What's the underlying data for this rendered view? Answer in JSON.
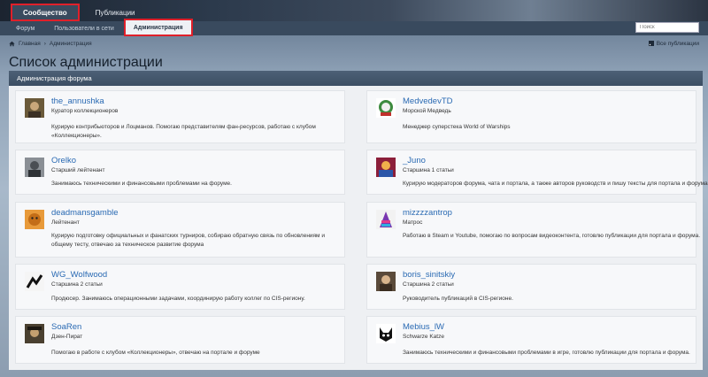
{
  "topnav": {
    "tabs": [
      "Сообщество",
      "Публикации"
    ]
  },
  "subnav": {
    "items": [
      "Форум",
      "Пользователи в сети",
      "Администрация"
    ]
  },
  "search": {
    "placeholder": "Поиск"
  },
  "breadcrumb": {
    "home": "Главная",
    "current": "Администрация"
  },
  "all_publications": "Все публикации",
  "page_title": "Список администрации",
  "section_title": "Администрация форума",
  "members": [
    {
      "name": "the_annushka",
      "rank": "Куратор коллекционеров",
      "bio": "Курирую контрибьюторов и Лоцманов. Помогаю представителям фан-ресурсов, работаю с клубом «Коллекционеры»."
    },
    {
      "name": "MedvedevTD",
      "rank": "Морской Медведь",
      "bio": "Менеджер суперстека World of Warships"
    },
    {
      "name": "Orelko",
      "rank": "Старший лейтенант",
      "bio": "Занимаюсь техническими и финансовыми проблемами на форуме."
    },
    {
      "name": "_Juno",
      "rank": "Старшина 1 статьи",
      "bio": "Курирую модераторов форума, чата и портала, а также авторов руководств и пишу тексты для портала и форума"
    },
    {
      "name": "deadmansgamble",
      "rank": "Лейтенант",
      "bio": "Курирую подготовку официальных и фанатских турниров, собираю обратную связь по обновлениям и общему тесту, отвечаю за техническое развитие форума"
    },
    {
      "name": "mizzzzantrop",
      "rank": "Матрос",
      "bio": "Работаю в Steam и Youtube, помогаю по вопросам видеоконтента, готовлю публикации для портала и форума."
    },
    {
      "name": "WG_Wolfwood",
      "rank": "Старшина 2 статьи",
      "bio": "Продюсер. Занимаюсь операционными задачами, координирую работу коллег по CIS-региону."
    },
    {
      "name": "boris_sinitskiy",
      "rank": "Старшина 2 статьи",
      "bio": "Руководитель публикаций в CIS-регионе."
    },
    {
      "name": "SoaRen",
      "rank": "Дзен-Пират",
      "bio": "Помогаю в работе с клубом «Коллекционеры», отвечаю на портале и форуме"
    },
    {
      "name": "Mebius_lW",
      "rank": "Schwarze Katze",
      "bio": "Занимаюсь техническими и финансовыми проблемами в игре, готовлю публикации для портала и форума."
    }
  ],
  "colors": {
    "accent": "#2a6ab3",
    "highlight": "#e0202a",
    "nav": "#394a5e"
  },
  "icons": {
    "home": "home-icon",
    "rss": "rss-icon"
  }
}
